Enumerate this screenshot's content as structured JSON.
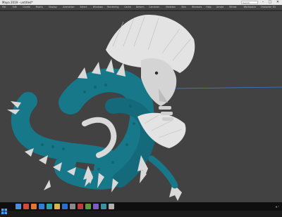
{
  "window": {
    "title": "Maya 2019 - untitled*",
    "search_placeholder": "Search",
    "min": "–",
    "max": "□",
    "close": "✕"
  },
  "menubar": {
    "items": [
      "File",
      "Edit",
      "Create",
      "Modify",
      "Display",
      "Animation",
      "Select",
      "Windows",
      "Rendering",
      "Cache",
      "Deform",
      "Constrain",
      "Skeleton",
      "Skin",
      "Windows",
      "Help",
      "Arnold",
      "Bifrost",
      "Workspace",
      "Character 3D"
    ]
  },
  "taskbar": {
    "start_icon": "windows-icon",
    "apps": [
      {
        "icon": "file-explorer-icon",
        "color": "#4a90d9"
      },
      {
        "icon": "chrome-icon",
        "color": "#d24a3a"
      },
      {
        "icon": "firefox-icon",
        "color": "#e8762a"
      },
      {
        "icon": "edge-icon",
        "color": "#2f7ed8"
      },
      {
        "icon": "maya-icon",
        "color": "#2aa6a6"
      },
      {
        "icon": "folder-icon",
        "color": "#d9b44a"
      },
      {
        "icon": "photoshop-icon",
        "color": "#2d6fd0"
      },
      {
        "icon": "zbrush-icon",
        "color": "#8a8a8a"
      },
      {
        "icon": "app-icon",
        "color": "#c23b3b"
      },
      {
        "icon": "app-icon-2",
        "color": "#5d9b3a"
      },
      {
        "icon": "app-icon-3",
        "color": "#7c5cc4"
      },
      {
        "icon": "app-icon-4",
        "color": "#3a8fa8"
      },
      {
        "icon": "app-icon-5",
        "color": "#b0b0b0"
      }
    ]
  },
  "viewport": {
    "subject": "dragon-model",
    "body_color": "#17788a",
    "spike_color": "#d9d9d9",
    "ground_line_color": "#3b7fd6"
  }
}
